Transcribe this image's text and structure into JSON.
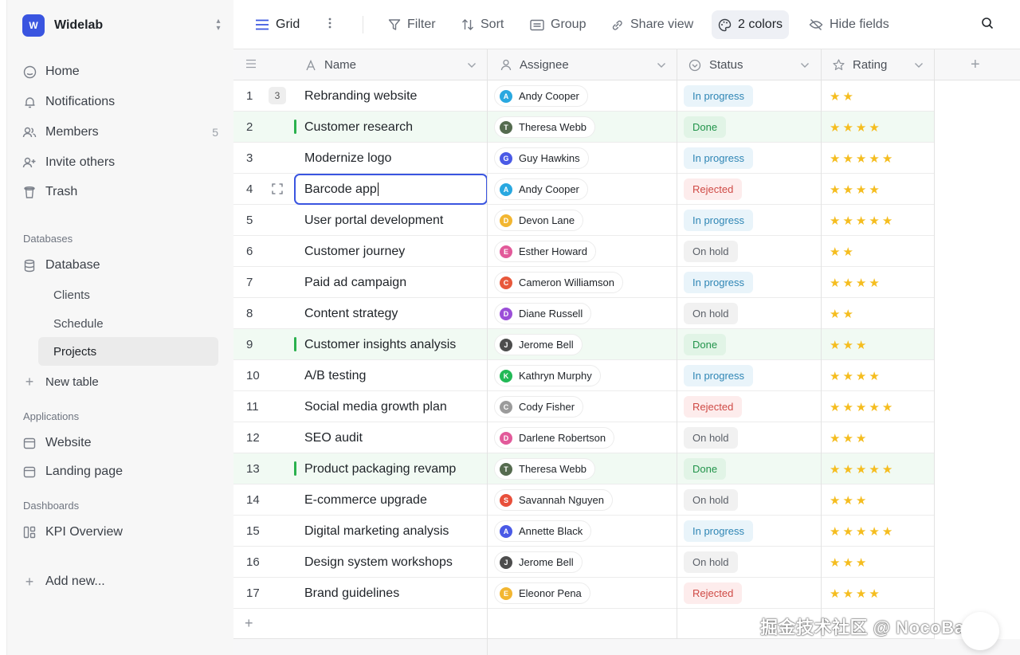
{
  "workspace": {
    "logo": "W",
    "name": "Widelab"
  },
  "sidebar": {
    "nav": [
      {
        "label": "Home",
        "icon": "home-icon"
      },
      {
        "label": "Notifications",
        "icon": "bell-icon"
      },
      {
        "label": "Members",
        "icon": "members-icon",
        "count": "5"
      },
      {
        "label": "Invite others",
        "icon": "invite-icon"
      },
      {
        "label": "Trash",
        "icon": "trash-icon"
      }
    ],
    "databases_heading": "Databases",
    "database_label": "Database",
    "tables": [
      "Clients",
      "Schedule",
      "Projects"
    ],
    "active_table": "Projects",
    "new_table": "New table",
    "applications_heading": "Applications",
    "applications": [
      "Website",
      "Landing page"
    ],
    "dashboards_heading": "Dashboards",
    "dashboards": [
      "KPI Overview"
    ],
    "add_new": "Add new..."
  },
  "toolbar": {
    "view": "Grid",
    "filter": "Filter",
    "sort": "Sort",
    "group": "Group",
    "share": "Share view",
    "colors": "2 colors",
    "hide": "Hide fields"
  },
  "columns": {
    "name": "Name",
    "assignee": "Assignee",
    "status": "Status",
    "rating": "Rating"
  },
  "rows": [
    {
      "num": "1",
      "badge": "3",
      "name": "Rebranding website",
      "assignee": "Andy Cooper",
      "initial": "A",
      "avatar": "#29a8e0",
      "status": "In progress",
      "rating": 2
    },
    {
      "num": "2",
      "name": "Customer research",
      "assignee": "Theresa Webb",
      "initial": "T",
      "avatar": "#556b4f",
      "status": "Done",
      "rating": 4
    },
    {
      "num": "3",
      "name": "Modernize logo",
      "assignee": "Guy Hawkins",
      "initial": "G",
      "avatar": "#4a5ae6",
      "status": "In progress",
      "rating": 5
    },
    {
      "num": "4",
      "name": "Barcode app",
      "assignee": "Andy Cooper",
      "initial": "A",
      "avatar": "#29a8e0",
      "status": "Rejected",
      "rating": 4,
      "editing": true
    },
    {
      "num": "5",
      "name": "User portal development",
      "assignee": "Devon Lane",
      "initial": "D",
      "avatar": "#f2b631",
      "status": "In progress",
      "rating": 5
    },
    {
      "num": "6",
      "name": "Customer journey",
      "assignee": "Esther Howard",
      "initial": "E",
      "avatar": "#e25a9a",
      "status": "On hold",
      "rating": 2
    },
    {
      "num": "7",
      "name": "Paid ad campaign",
      "assignee": "Cameron Williamson",
      "initial": "C",
      "avatar": "#e8583b",
      "status": "In progress",
      "rating": 4
    },
    {
      "num": "8",
      "name": "Content strategy",
      "assignee": "Diane Russell",
      "initial": "D",
      "avatar": "#9b4fd8",
      "status": "On hold",
      "rating": 2
    },
    {
      "num": "9",
      "name": "Customer insights analysis",
      "assignee": "Jerome Bell",
      "initial": "J",
      "avatar": "#4d4d4d",
      "status": "Done",
      "rating": 3
    },
    {
      "num": "10",
      "name": "A/B testing",
      "assignee": "Kathryn Murphy",
      "initial": "K",
      "avatar": "#22b956",
      "status": "In progress",
      "rating": 4
    },
    {
      "num": "11",
      "name": "Social media growth plan",
      "assignee": "Cody Fisher",
      "initial": "C",
      "avatar": "#9b9b9b",
      "status": "Rejected",
      "rating": 5
    },
    {
      "num": "12",
      "name": "SEO audit",
      "assignee": "Darlene Robertson",
      "initial": "D",
      "avatar": "#e25a9a",
      "status": "On hold",
      "rating": 3
    },
    {
      "num": "13",
      "name": "Product packaging revamp",
      "assignee": "Theresa Webb",
      "initial": "T",
      "avatar": "#556b4f",
      "status": "Done",
      "rating": 5
    },
    {
      "num": "14",
      "name": "E-commerce upgrade",
      "assignee": "Savannah Nguyen",
      "initial": "S",
      "avatar": "#e8503b",
      "status": "On hold",
      "rating": 3
    },
    {
      "num": "15",
      "name": "Digital marketing analysis",
      "assignee": "Annette Black",
      "initial": "A",
      "avatar": "#4a5ae6",
      "status": "In progress",
      "rating": 5
    },
    {
      "num": "16",
      "name": "Design system workshops",
      "assignee": "Jerome Bell",
      "initial": "J",
      "avatar": "#4d4d4d",
      "status": "On hold",
      "rating": 3
    },
    {
      "num": "17",
      "name": "Brand guidelines",
      "assignee": "Eleonor Pena",
      "initial": "E",
      "avatar": "#f2b631",
      "status": "Rejected",
      "rating": 4
    }
  ],
  "watermark": "掘金技术社区 @ NocoBase"
}
